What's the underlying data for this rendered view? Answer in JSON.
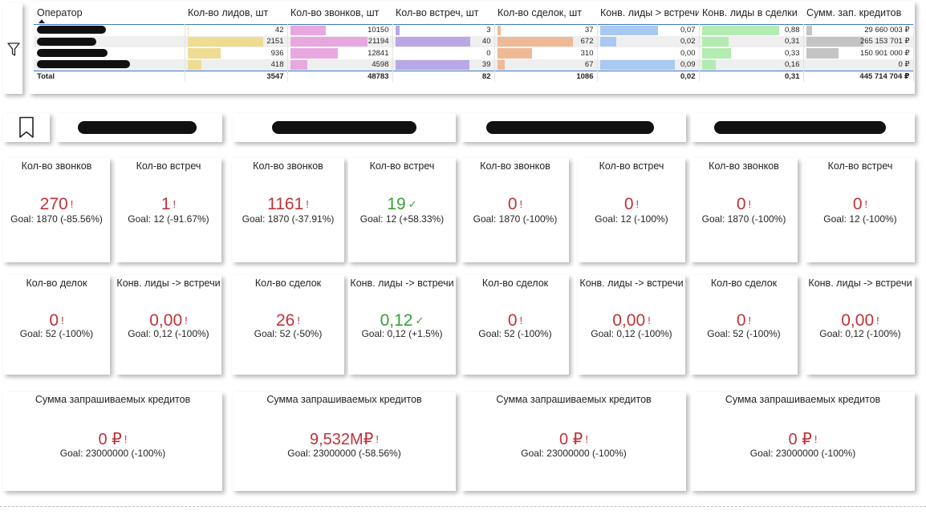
{
  "table": {
    "columns": [
      "Оператор",
      "Кол-во лидов, шт",
      "Кол-во звонков, шт",
      "Кол-во встреч, шт",
      "Кол-во сделок, шт",
      "Конв. лиды > встречи",
      "Конв. лиды в сделки",
      "Сумм. зап. кредитов"
    ],
    "rows": [
      {
        "operator": "",
        "leads": "42",
        "calls": "10150",
        "meetings": "3",
        "deals": "37",
        "conv_meet": "0,07",
        "conv_deal": "0,88",
        "credit": "29 660 003 ₽",
        "leads_frac": 0.02,
        "calls_frac": 0.46,
        "meetings_frac": 0.06,
        "deals_frac": 0.05,
        "conv_meet_frac": 0.77,
        "conv_deal_frac": 1.0,
        "credit_frac": 0.11
      },
      {
        "operator": "",
        "leads": "2151",
        "calls": "21194",
        "meetings": "40",
        "deals": "672",
        "conv_meet": "0,02",
        "conv_deal": "0,31",
        "credit": "265 153 701 ₽",
        "leads_frac": 1.0,
        "calls_frac": 1.0,
        "meetings_frac": 1.0,
        "deals_frac": 1.0,
        "conv_meet_frac": 0.22,
        "conv_deal_frac": 0.35,
        "credit_frac": 1.0
      },
      {
        "operator": "",
        "leads": "936",
        "calls": "12841",
        "meetings": "0",
        "deals": "310",
        "conv_meet": "0,00",
        "conv_deal": "0,33",
        "credit": "150 901 000 ₽",
        "leads_frac": 0.44,
        "calls_frac": 0.61,
        "meetings_frac": 0.0,
        "deals_frac": 0.46,
        "conv_meet_frac": 0.0,
        "conv_deal_frac": 0.38,
        "credit_frac": 0.57
      },
      {
        "operator": "",
        "leads": "418",
        "calls": "4598",
        "meetings": "39",
        "deals": "67",
        "conv_meet": "0,09",
        "conv_deal": "0,16",
        "credit": "0 ₽",
        "leads_frac": 0.19,
        "calls_frac": 0.22,
        "meetings_frac": 0.98,
        "deals_frac": 0.1,
        "conv_meet_frac": 1.0,
        "conv_deal_frac": 0.18,
        "credit_frac": 0.0
      }
    ],
    "total": {
      "label": "Total",
      "leads": "3547",
      "calls": "48783",
      "meetings": "82",
      "deals": "1086",
      "conv_meet": "0,02",
      "conv_deal": "0,31",
      "credit": "445 714 704 ₽"
    },
    "bar_colors": {
      "leads": "#eedc93",
      "calls": "#e8a8df",
      "meetings": "#b9a7e6",
      "deals": "#f0b996",
      "conv_meet": "#a9c8f2",
      "conv_deal": "#b2ecb0",
      "credit": "#c4c4c4"
    }
  },
  "icons": {
    "filter": "filter-icon",
    "bookmark": "bookmark-icon"
  },
  "colors": {
    "bad": "#c0323a",
    "good": "#37a035",
    "accent": "#3b79c8"
  },
  "kpi_row1": [
    {
      "title": "Кол-во звонков",
      "value": "270",
      "flag": "!",
      "status": "bad",
      "goal": "Goal: 1870 (-85.56%)"
    },
    {
      "title": "Кол-во встреч",
      "value": "1",
      "flag": "!",
      "status": "bad",
      "goal": "Goal: 12 (-91.67%)"
    },
    {
      "title": "Кол-во звонков",
      "value": "1161",
      "flag": "!",
      "status": "bad",
      "goal": "Goal: 1870 (-37.91%)"
    },
    {
      "title": "Кол-во встреч",
      "value": "19",
      "flag": "✓",
      "status": "good",
      "goal": "Goal: 12 (+58.33%)"
    },
    {
      "title": "Кол-во звонков",
      "value": "0",
      "flag": "!",
      "status": "bad",
      "goal": "Goal: 1870 (-100%)"
    },
    {
      "title": "Кол-во встреч",
      "value": "0",
      "flag": "!",
      "status": "bad",
      "goal": "Goal: 12 (-100%)"
    },
    {
      "title": "Кол-во звонков",
      "value": "0",
      "flag": "!",
      "status": "bad",
      "goal": "Goal: 1870 (-100%)"
    },
    {
      "title": "Кол-во встреч",
      "value": "0",
      "flag": "!",
      "status": "bad",
      "goal": "Goal: 12 (-100%)"
    }
  ],
  "kpi_row2": [
    {
      "title": "Кол-во делок",
      "value": "0",
      "flag": "!",
      "status": "bad",
      "goal": "Goal: 52 (-100%)"
    },
    {
      "title": "Конв. лиды -> встречи",
      "value": "0,00",
      "flag": "!",
      "status": "bad",
      "goal": "Goal: 0,12 (-100%)"
    },
    {
      "title": "Кол-во сделок",
      "value": "26",
      "flag": "!",
      "status": "bad",
      "goal": "Goal: 52 (-50%)"
    },
    {
      "title": "Конв. лиды -> встречи",
      "value": "0,12",
      "flag": "✓",
      "status": "good",
      "goal": "Goal: 0,12 (+1.5%)"
    },
    {
      "title": "Кол-во сделок",
      "value": "0",
      "flag": "!",
      "status": "bad",
      "goal": "Goal: 52 (-100%)"
    },
    {
      "title": "Конв. лиды -> встречи",
      "value": "0,00",
      "flag": "!",
      "status": "bad",
      "goal": "Goal: 0,12 (-100%)"
    },
    {
      "title": "Кол-во сделок",
      "value": "0",
      "flag": "!",
      "status": "bad",
      "goal": "Goal: 52 (-100%)"
    },
    {
      "title": "Конв. лиды -> встречи",
      "value": "0,00",
      "flag": "!",
      "status": "bad",
      "goal": "Goal: 0,12 (-100%)"
    }
  ],
  "kpi_row3": [
    {
      "title": "Сумма запрашиваемых кредитов",
      "value": "0 ₽",
      "flag": "!",
      "status": "bad",
      "goal": "Goal: 23000000 (-100%)"
    },
    {
      "title": "Сумма запрашиваемых кредитов",
      "value": "9,532M₽",
      "flag": "!",
      "status": "bad",
      "goal": "Goal: 23000000 (-58.56%)"
    },
    {
      "title": "Сумма запрашиваемых кредитов",
      "value": "0 ₽",
      "flag": "!",
      "status": "bad",
      "goal": "Goal: 23000000 (-100%)"
    },
    {
      "title": "Сумма запрашиваемых кредитов",
      "value": "0 ₽",
      "flag": "!",
      "status": "bad",
      "goal": "Goal: 23000000 (-100%)"
    }
  ]
}
